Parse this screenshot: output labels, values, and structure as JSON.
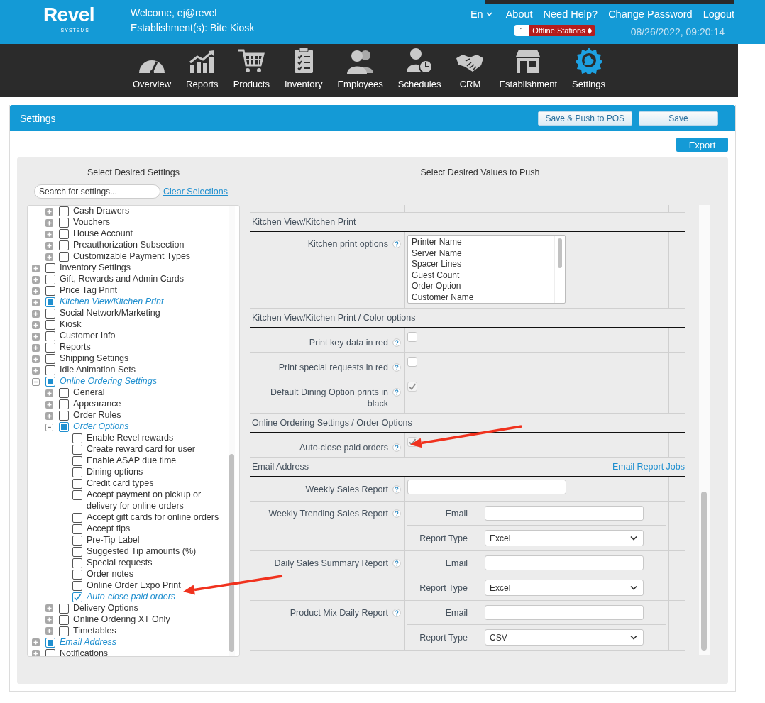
{
  "header": {
    "logo": "Revel",
    "logo_sub": "SYSTEMS",
    "welcome": "Welcome, ej@revel",
    "establishment": "Establishment(s): Bite Kiosk",
    "language": "En",
    "links": [
      "About",
      "Need Help?",
      "Change Password",
      "Logout"
    ],
    "offline_count": "1",
    "offline_label": "Offline Stations",
    "datetime": "08/26/2022, 09:20:14"
  },
  "nav": [
    {
      "label": "Overview",
      "selected": false
    },
    {
      "label": "Reports",
      "selected": false
    },
    {
      "label": "Products",
      "selected": false
    },
    {
      "label": "Inventory",
      "selected": false
    },
    {
      "label": "Employees",
      "selected": false
    },
    {
      "label": "Schedules",
      "selected": false
    },
    {
      "label": "CRM",
      "selected": false
    },
    {
      "label": "Establishment",
      "selected": false
    },
    {
      "label": "Settings",
      "selected": true
    }
  ],
  "settings": {
    "title": "Settings",
    "buttons": [
      "Save & Push to POS",
      "Save"
    ],
    "export": "Export"
  },
  "left": {
    "heading": "Select Desired Settings",
    "search_placeholder": "Search for settings...",
    "clear": "Clear Selections"
  },
  "tree": {
    "continued_items": [
      {
        "label": "Cash Drawers",
        "checked": false,
        "partial": false,
        "expanded": false
      },
      {
        "label": "Vouchers",
        "checked": false,
        "partial": false,
        "expanded": false
      },
      {
        "label": "House Account",
        "checked": false,
        "partial": false,
        "expanded": false
      },
      {
        "label": "Preauthorization Subsection",
        "checked": false,
        "partial": false,
        "expanded": false
      },
      {
        "label": "Customizable Payment Types",
        "checked": false,
        "partial": false,
        "expanded": false
      }
    ],
    "items": [
      {
        "label": "Inventory Settings",
        "checked": false,
        "partial": false,
        "expanded": false
      },
      {
        "label": "Gift, Rewards and Admin Cards",
        "checked": false,
        "partial": false,
        "expanded": false
      },
      {
        "label": "Price Tag Print",
        "checked": false,
        "partial": false,
        "expanded": false
      },
      {
        "label": "Kitchen View/Kitchen Print",
        "checked": false,
        "partial": true,
        "expanded": false
      },
      {
        "label": "Social Network/Marketing",
        "checked": false,
        "partial": false,
        "expanded": false
      },
      {
        "label": "Kiosk",
        "checked": false,
        "partial": false,
        "expanded": false
      },
      {
        "label": "Customer Info",
        "checked": false,
        "partial": false,
        "expanded": false
      },
      {
        "label": "Reports",
        "checked": false,
        "partial": false,
        "expanded": false
      },
      {
        "label": "Shipping Settings",
        "checked": false,
        "partial": false,
        "expanded": false
      },
      {
        "label": "Idle Animation Sets",
        "checked": false,
        "partial": false,
        "expanded": false
      },
      {
        "label": "Online Ordering Settings",
        "checked": false,
        "partial": true,
        "expanded": true,
        "children": [
          {
            "label": "General",
            "checked": false,
            "partial": false,
            "expanded": false
          },
          {
            "label": "Appearance",
            "checked": false,
            "partial": false,
            "expanded": false
          },
          {
            "label": "Order Rules",
            "checked": false,
            "partial": false,
            "expanded": false
          },
          {
            "label": "Order Options",
            "checked": false,
            "partial": true,
            "expanded": true,
            "children": [
              {
                "label": "Enable Revel rewards",
                "checked": false
              },
              {
                "label": "Create reward card for user",
                "checked": false
              },
              {
                "label": "Enable ASAP due time",
                "checked": false
              },
              {
                "label": "Dining options",
                "checked": false
              },
              {
                "label": "Credit card types",
                "checked": false
              },
              {
                "label": "Accept payment on pickup or delivery for online orders",
                "checked": false
              },
              {
                "label": "Accept gift cards for online orders",
                "checked": false
              },
              {
                "label": "Accept tips",
                "checked": false
              },
              {
                "label": "Pre-Tip Label",
                "checked": false
              },
              {
                "label": "Suggested Tip amounts (%)",
                "checked": false
              },
              {
                "label": "Special requests",
                "checked": false
              },
              {
                "label": "Order notes",
                "checked": false
              },
              {
                "label": "Online Order Expo Print",
                "checked": false
              },
              {
                "label": "Auto-close paid orders",
                "checked": true
              }
            ]
          },
          {
            "label": "Delivery Options",
            "checked": false,
            "partial": false,
            "expanded": false
          },
          {
            "label": "Online Ordering XT Only",
            "checked": false,
            "partial": false,
            "expanded": false
          },
          {
            "label": "Timetables",
            "checked": false,
            "partial": false,
            "expanded": false
          }
        ]
      },
      {
        "label": "Email Address",
        "checked": false,
        "partial": true,
        "expanded": false
      },
      {
        "label": "Notifications",
        "checked": false,
        "partial": false,
        "expanded": false
      }
    ]
  },
  "right": {
    "heading": "Select Desired Values to Push",
    "sections": [
      {
        "title": "Kitchen View/Kitchen Print",
        "rows": [
          {
            "kind": "listbox",
            "label": "Kitchen print options",
            "options": [
              "Printer Name",
              "Server Name",
              "Spacer Lines",
              "Guest Count",
              "Order Option",
              "Customer Name"
            ]
          }
        ]
      },
      {
        "title": "Kitchen View/Kitchen Print / Color options",
        "rows": [
          {
            "kind": "checkbox",
            "label": "Print key data in red",
            "checked": false,
            "disabled": false
          },
          {
            "kind": "checkbox",
            "label": "Print special requests in red",
            "checked": false,
            "disabled": false
          },
          {
            "kind": "checkbox",
            "label": "Default Dining Option prints in black",
            "checked": true,
            "disabled": true
          }
        ]
      },
      {
        "title": "Online Ordering Settings / Order Options",
        "rows": [
          {
            "kind": "checkbox",
            "label": "Auto-close paid orders",
            "checked": true,
            "disabled": true
          }
        ]
      },
      {
        "title": "Email Address",
        "link": "Email Report Jobs",
        "rows": [
          {
            "kind": "text",
            "label": "Weekly Sales Report"
          },
          {
            "kind": "report",
            "label": "Weekly Trending Sales Report",
            "email_label": "Email",
            "type_label": "Report Type",
            "type": "Excel"
          },
          {
            "kind": "report",
            "label": "Daily Sales Summary Report",
            "email_label": "Email",
            "type_label": "Report Type",
            "type": "Excel"
          },
          {
            "kind": "report",
            "label": "Product Mix Daily Report",
            "email_label": "Email",
            "type_label": "Report Type",
            "type": "CSV"
          }
        ]
      }
    ]
  }
}
